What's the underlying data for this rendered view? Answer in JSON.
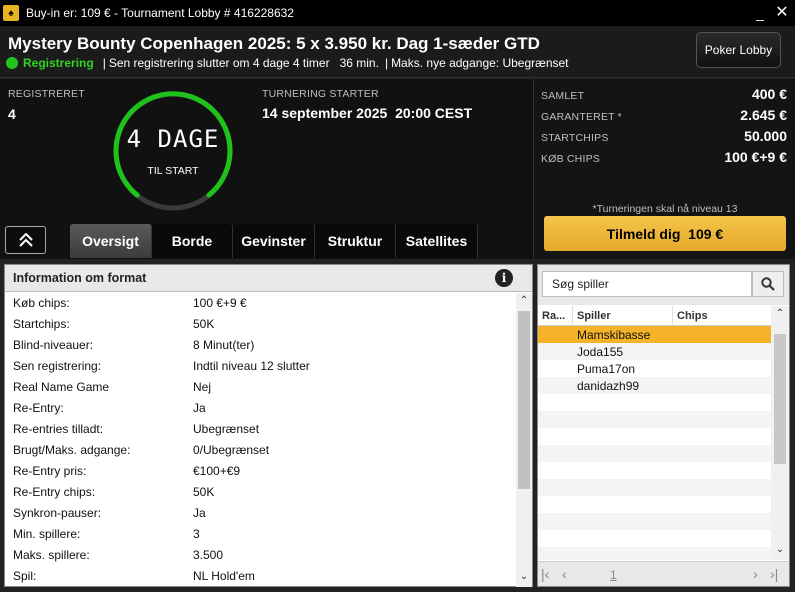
{
  "window": {
    "title": "Buy-in er: 109 € - Tournament Lobby # 416228632",
    "minimize": "_",
    "close": "✕"
  },
  "header": {
    "tournament_name": "Mystery Bounty Copenhagen 2025: 5 x 3.950 kr. Dag 1-sæder GTD",
    "status": "Registrering",
    "late_reg": "Sen registrering slutter om 4 dage 4 timer   36 min.",
    "max_entries": "Maks. nye adgange: Ubegrænset",
    "separator": "|",
    "poker_lobby_label": "Poker Lobby",
    "status_color": "#24c51b"
  },
  "summary": {
    "registered_label": "REGISTRERET",
    "registered_value": "4",
    "countdown_value": "4 DAGE",
    "countdown_caption": "TIL START",
    "start_label": "TURNERING STARTER",
    "start_value": "14 september 2025  20:00 CEST"
  },
  "prize": {
    "rows": [
      {
        "label": "SAMLET",
        "value": "400 €"
      },
      {
        "label": "GARANTERET *",
        "value": "2.645 €"
      },
      {
        "label": "STARTCHIPS",
        "value": "50.000"
      },
      {
        "label": "KØB CHIPS",
        "value": "100 €+9 €"
      }
    ],
    "note": "*Turneringen skal nå niveau 13",
    "register_label": "Tilmeld dig  109 €",
    "register_color": "#f0bd40"
  },
  "tabs": [
    {
      "label": "Oversigt",
      "active": true
    },
    {
      "label": "Borde"
    },
    {
      "label": "Gevinster"
    },
    {
      "label": "Struktur"
    },
    {
      "label": "Satellites"
    }
  ],
  "format": {
    "title": "Information om format",
    "info_icon": "i",
    "rows": [
      {
        "k": "Køb chips:",
        "v": "100 €+9 €"
      },
      {
        "k": "Startchips:",
        "v": "50K"
      },
      {
        "k": "Blind-niveauer:",
        "v": "8 Minut(ter)"
      },
      {
        "k": "Sen registrering:",
        "v": "Indtil niveau 12 slutter"
      },
      {
        "k": "Real Name Game",
        "v": "Nej"
      },
      {
        "k": "Re-Entry:",
        "v": "Ja"
      },
      {
        "k": "Re-entries tilladt:",
        "v": "Ubegrænset"
      },
      {
        "k": "Brugt/Maks. adgange:",
        "v": "0/Ubegrænset"
      },
      {
        "k": "Re-Entry pris:",
        "v": "€100+€9"
      },
      {
        "k": "Re-Entry chips:",
        "v": "50K"
      },
      {
        "k": "Synkron-pauser:",
        "v": "Ja"
      },
      {
        "k": "Min. spillere:",
        "v": "3"
      },
      {
        "k": "Maks. spillere:",
        "v": "3.500"
      },
      {
        "k": "Spil:",
        "v": "NL Hold'em"
      }
    ]
  },
  "players": {
    "search_placeholder": "Søg spiller",
    "columns": [
      "Ra...",
      "Spiller",
      "Chips"
    ],
    "rows": [
      {
        "rank": "",
        "name": "Mamskibasse",
        "chips": "",
        "selected": true
      },
      {
        "rank": "",
        "name": "Joda155",
        "chips": ""
      },
      {
        "rank": "",
        "name": "Puma17on",
        "chips": ""
      },
      {
        "rank": "",
        "name": "danidazh99",
        "chips": ""
      }
    ],
    "page": "1"
  }
}
